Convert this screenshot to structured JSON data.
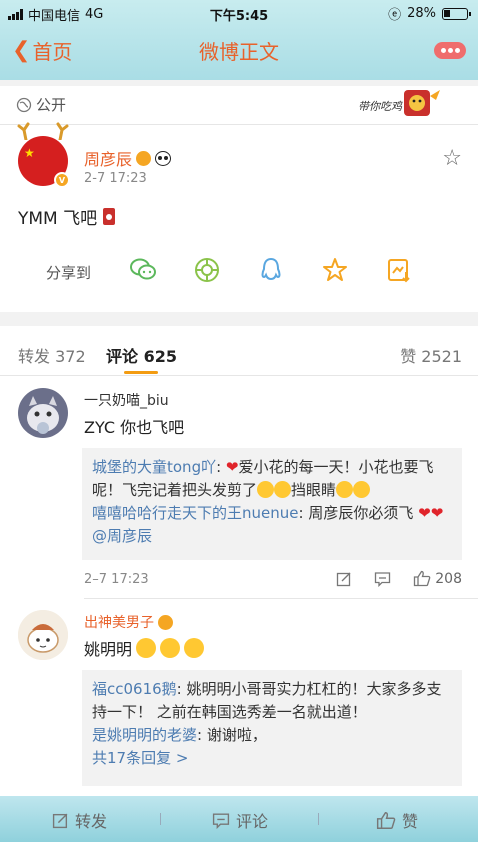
{
  "status_bar": {
    "carrier": "中国电信",
    "network": "4G",
    "time": "下午5:45",
    "battery": "28%",
    "battery_level": 0.28
  },
  "nav": {
    "back_label": "首页",
    "title": "微博正文",
    "more_icon": "more-icon"
  },
  "post": {
    "visibility": "公开",
    "banner_text": "带你吃鸡",
    "author": "周彦辰",
    "time": "2-7 17:23",
    "text": "YMM 飞吧",
    "share_label": "分享到",
    "share_icons": [
      "wechat-icon",
      "moments-icon",
      "qq-icon",
      "qzone-icon",
      "save-icon"
    ]
  },
  "tabs": {
    "repost": "转发 372",
    "comment": "评论 625",
    "like": "赞 2521"
  },
  "comments": [
    {
      "user": "一只奶喵_biu",
      "text": "ZYC  你也飞吧",
      "replies": [
        {
          "user": "城堡的大童tong吖",
          "sep": ": ",
          "text1": "爱小花的每一天！小花也要飞呢！飞完记着把头发剪了",
          "text2": "挡眼睛"
        },
        {
          "user": "嘻嘻哈哈行走天下的王nuenue",
          "sep": ": ",
          "text1": "周彦辰你必须飞",
          "mention": "@周彦辰"
        }
      ],
      "time": "2–7 17:23",
      "likes": "208"
    },
    {
      "user": "出神美男子",
      "text": "姚明明",
      "replies": [
        {
          "user": "福cc0616鹅",
          "sep": ": ",
          "text": "姚明明小哥哥实力杠杠的！大家多多支持一下！ 之前在韩国选秀差一名就出道！"
        },
        {
          "user": "是姚明明的老婆",
          "sep": ": ",
          "text": "谢谢啦，"
        }
      ],
      "more_replies": "共17条回复 >"
    }
  ],
  "bottom_bar": {
    "repost": "转发",
    "comment": "评论",
    "like": "赞"
  },
  "colors": {
    "accent": "#e8622b",
    "link": "#4d7cb1",
    "header": "#a9dde5"
  }
}
